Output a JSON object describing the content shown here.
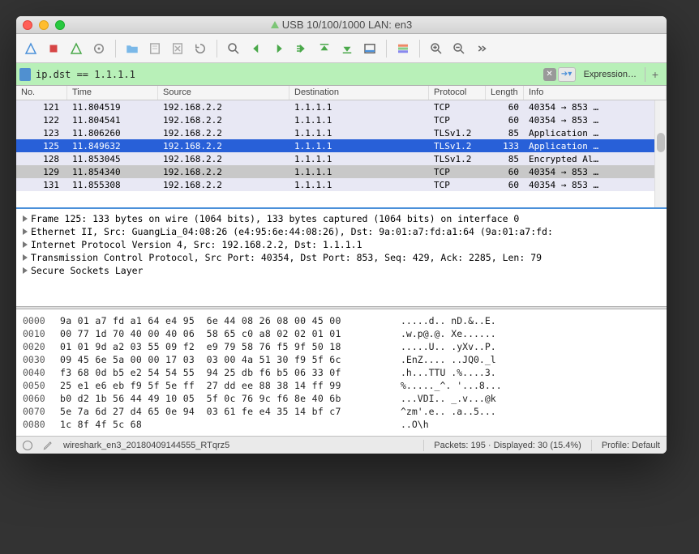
{
  "window": {
    "title": "USB 10/100/1000 LAN: en3"
  },
  "filter": {
    "value": "ip.dst == 1.1.1.1",
    "expression_label": "Expression…",
    "plus": "+"
  },
  "columns": {
    "no": "No.",
    "time": "Time",
    "source": "Source",
    "destination": "Destination",
    "protocol": "Protocol",
    "length": "Length",
    "info": "Info"
  },
  "packets": [
    {
      "no": "121",
      "time": "11.804519",
      "src": "192.168.2.2",
      "dst": "1.1.1.1",
      "proto": "TCP",
      "len": "60",
      "info": "40354 → 853 …",
      "style": "bg0"
    },
    {
      "no": "122",
      "time": "11.804541",
      "src": "192.168.2.2",
      "dst": "1.1.1.1",
      "proto": "TCP",
      "len": "60",
      "info": "40354 → 853 …",
      "style": "bg0"
    },
    {
      "no": "123",
      "time": "11.806260",
      "src": "192.168.2.2",
      "dst": "1.1.1.1",
      "proto": "TLSv1.2",
      "len": "85",
      "info": "Application …",
      "style": "bg0"
    },
    {
      "no": "125",
      "time": "11.849632",
      "src": "192.168.2.2",
      "dst": "1.1.1.1",
      "proto": "TLSv1.2",
      "len": "133",
      "info": "Application …",
      "style": "sel"
    },
    {
      "no": "128",
      "time": "11.853045",
      "src": "192.168.2.2",
      "dst": "1.1.1.1",
      "proto": "TLSv1.2",
      "len": "85",
      "info": "Encrypted Al…",
      "style": "bg0"
    },
    {
      "no": "129",
      "time": "11.854340",
      "src": "192.168.2.2",
      "dst": "1.1.1.1",
      "proto": "TCP",
      "len": "60",
      "info": "40354 → 853 …",
      "style": "rel"
    },
    {
      "no": "131",
      "time": "11.855308",
      "src": "192.168.2.2",
      "dst": "1.1.1.1",
      "proto": "TCP",
      "len": "60",
      "info": "40354 → 853 …",
      "style": "bg0"
    }
  ],
  "details": [
    "Frame 125: 133 bytes on wire (1064 bits), 133 bytes captured (1064 bits) on interface 0",
    "Ethernet II, Src: GuangLia_04:08:26 (e4:95:6e:44:08:26), Dst: 9a:01:a7:fd:a1:64 (9a:01:a7:fd:",
    "Internet Protocol Version 4, Src: 192.168.2.2, Dst: 1.1.1.1",
    "Transmission Control Protocol, Src Port: 40354, Dst Port: 853, Seq: 429, Ack: 2285, Len: 79",
    "Secure Sockets Layer"
  ],
  "hex": [
    {
      "off": "0000",
      "b": "9a 01 a7 fd a1 64 e4 95  6e 44 08 26 08 00 45 00",
      "a": ".....d.. nD.&..E."
    },
    {
      "off": "0010",
      "b": "00 77 1d 70 40 00 40 06  58 65 c0 a8 02 02 01 01",
      "a": ".w.p@.@. Xe......"
    },
    {
      "off": "0020",
      "b": "01 01 9d a2 03 55 09 f2  e9 79 58 76 f5 9f 50 18",
      "a": ".....U.. .yXv..P."
    },
    {
      "off": "0030",
      "b": "09 45 6e 5a 00 00 17 03  03 00 4a 51 30 f9 5f 6c",
      "a": ".EnZ.... ..JQ0._l"
    },
    {
      "off": "0040",
      "b": "f3 68 0d b5 e2 54 54 55  94 25 db f6 b5 06 33 0f",
      "a": ".h...TTU .%....3."
    },
    {
      "off": "0050",
      "b": "25 e1 e6 eb f9 5f 5e ff  27 dd ee 88 38 14 ff 99",
      "a": "%....._^. '...8..."
    },
    {
      "off": "0060",
      "b": "b0 d2 1b 56 44 49 10 05  5f 0c 76 9c f6 8e 40 6b",
      "a": "...VDI.. _.v...@k"
    },
    {
      "off": "0070",
      "b": "5e 7a 6d 27 d4 65 0e 94  03 61 fe e4 35 14 bf c7",
      "a": "^zm'.e.. .a..5..."
    },
    {
      "off": "0080",
      "b": "1c 8f 4f 5c 68",
      "a": "..O\\h"
    }
  ],
  "status": {
    "file": "wireshark_en3_20180409144555_RTqrz5",
    "packets": "Packets: 195 · Displayed: 30 (15.4%)",
    "profile": "Profile: Default"
  }
}
